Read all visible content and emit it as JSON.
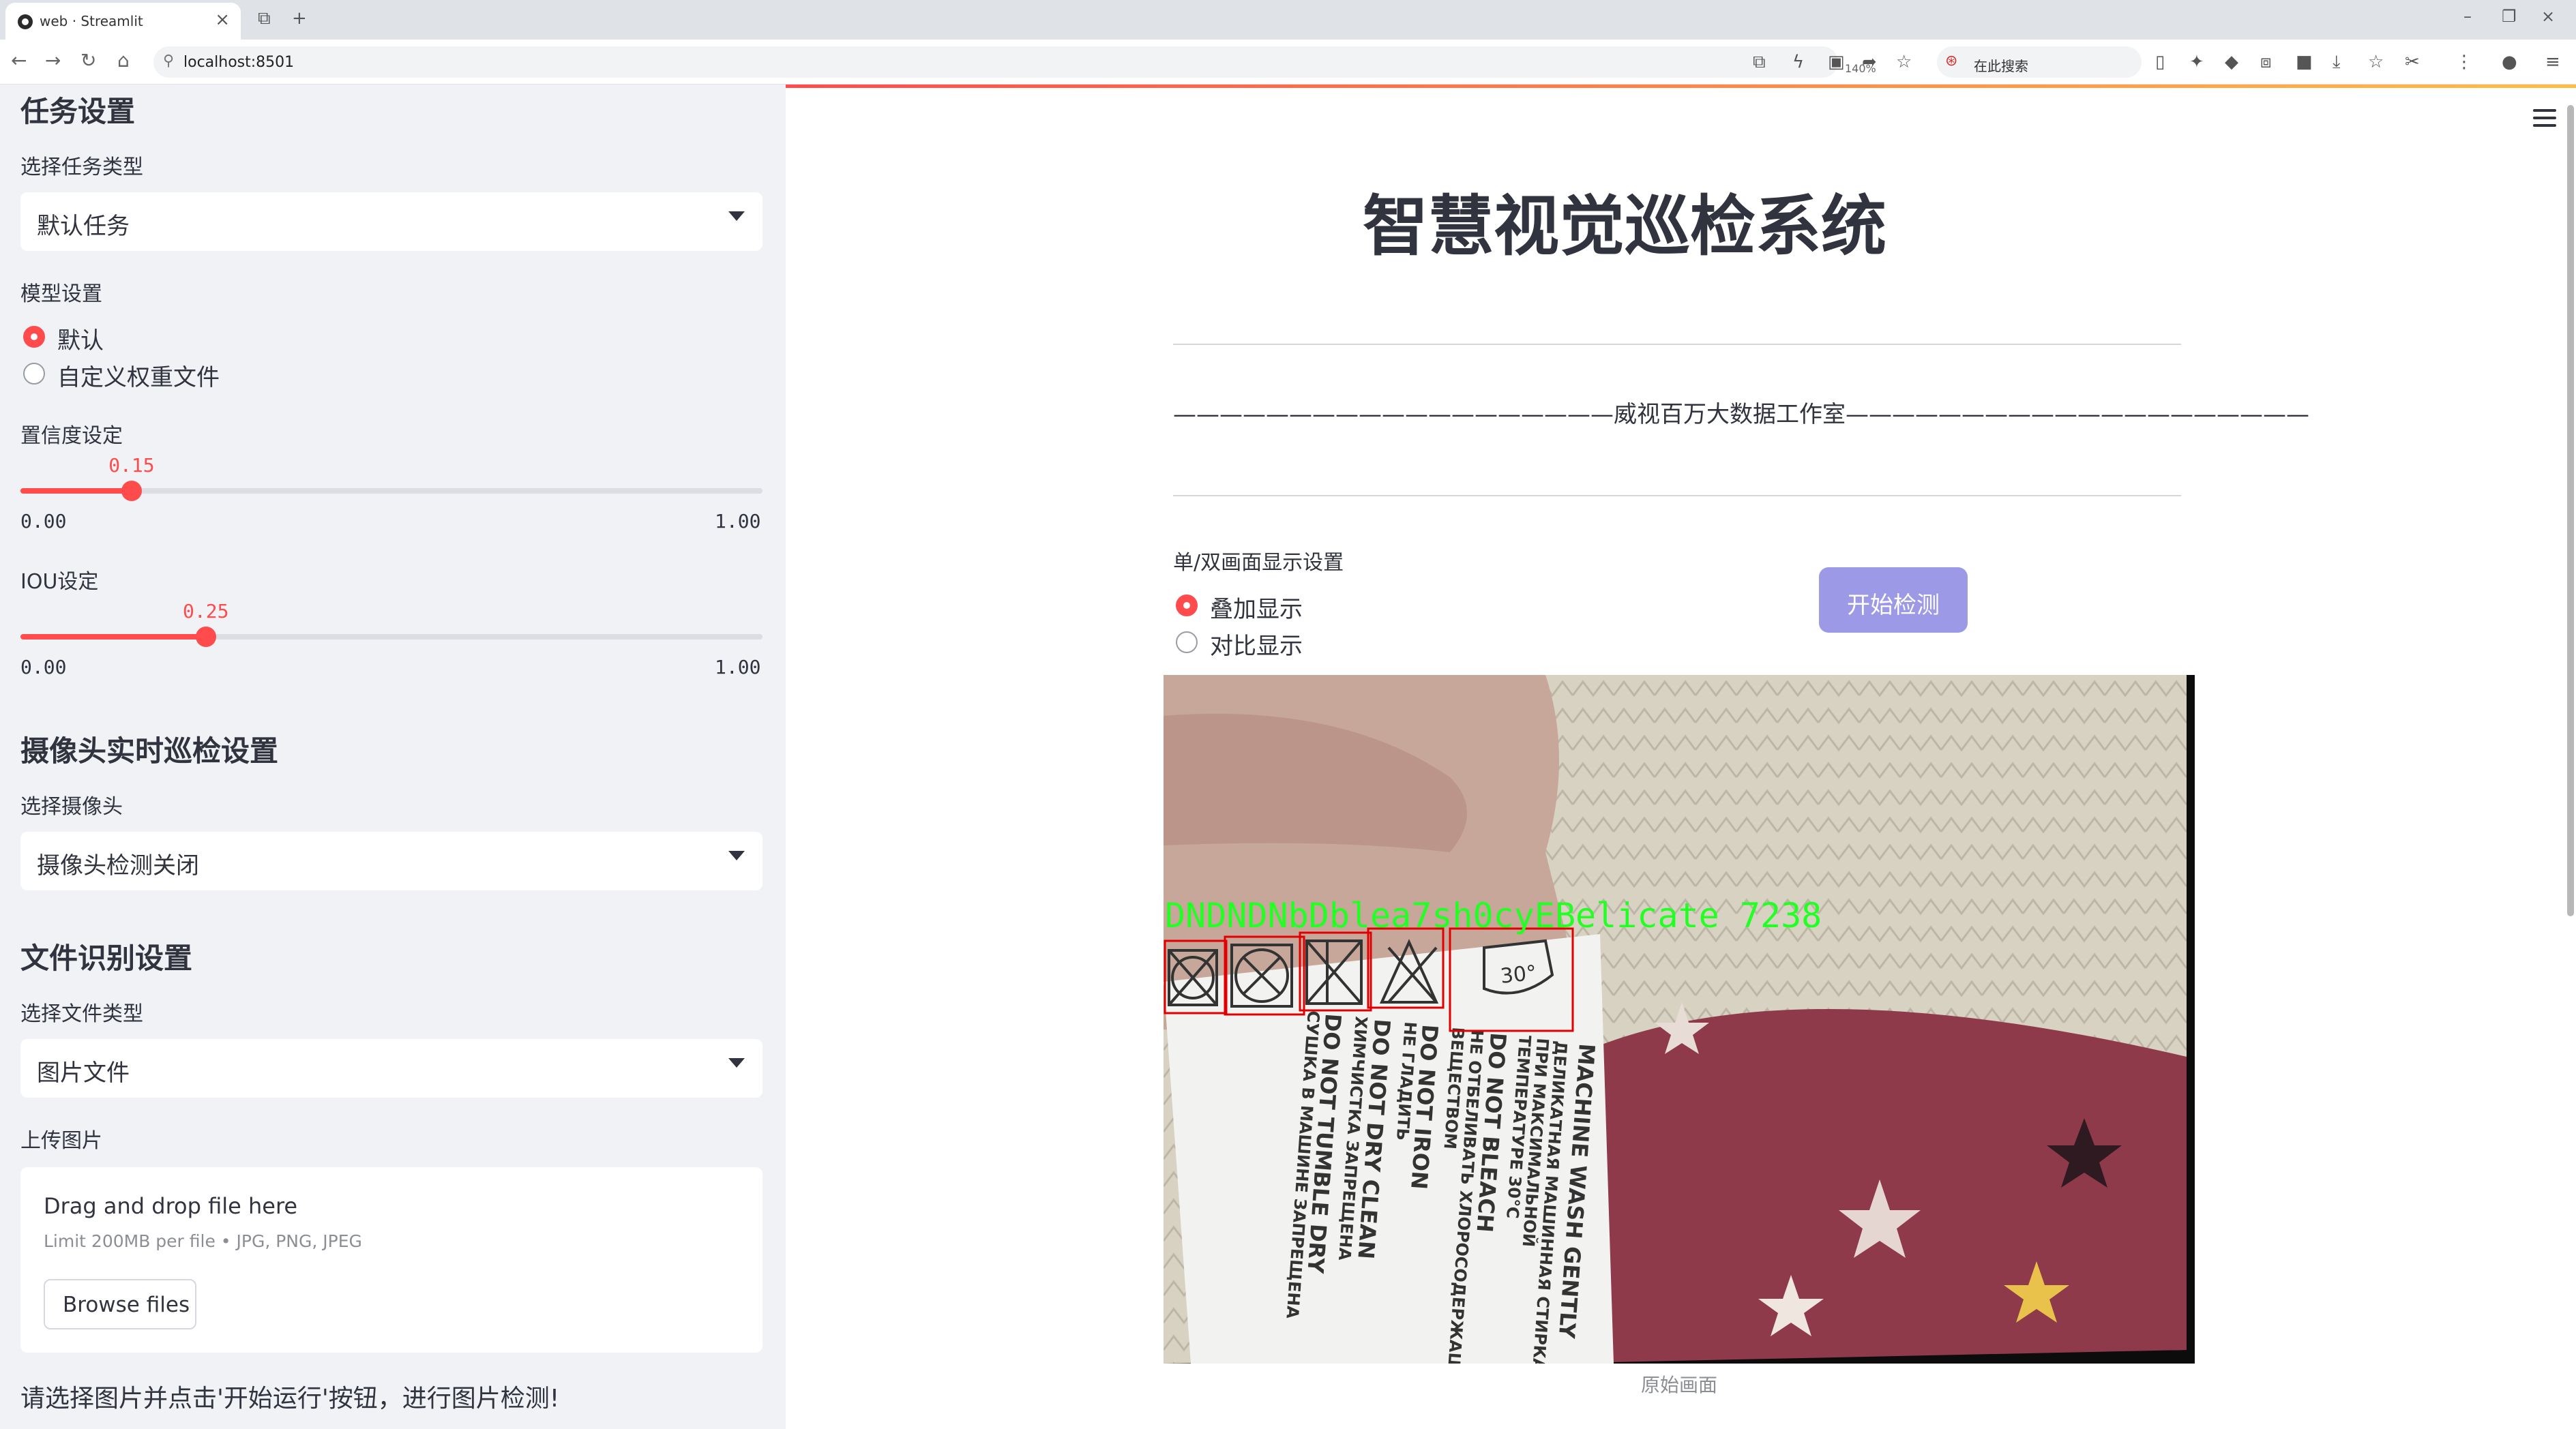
{
  "browser": {
    "tab_title": "web · Streamlit",
    "url": "localhost:8501",
    "zoom": "140%",
    "search_placeholder": "在此搜索"
  },
  "sidebar": {
    "task_section_title": "任务设置",
    "task_type_label": "选择任务类型",
    "task_type_value": "默认任务",
    "model_label": "模型设置",
    "model_options": [
      "默认",
      "自定义权重文件"
    ],
    "model_selected": "默认",
    "conf_label": "置信度设定",
    "conf_value": "0.15",
    "conf_min": "0.00",
    "conf_max": "1.00",
    "conf_fraction": 0.15,
    "iou_label": "IOU设定",
    "iou_value": "0.25",
    "iou_min": "0.00",
    "iou_max": "1.00",
    "iou_fraction": 0.25,
    "camera_section_title": "摄像头实时巡检设置",
    "camera_label": "选择摄像头",
    "camera_value": "摄像头检测关闭",
    "file_section_title": "文件识别设置",
    "file_type_label": "选择文件类型",
    "file_type_value": "图片文件",
    "upload_label": "上传图片",
    "upload_main": "Drag and drop file here",
    "upload_sub": "Limit 200MB per file • JPG, PNG, JPEG",
    "browse_label": "Browse files",
    "hint": "请选择图片并点击'开始运行'按钮，进行图片检测!"
  },
  "main": {
    "title": "智慧视觉巡检系统",
    "subtitle": "———————————————————威视百万大数据工作室————————————————————",
    "display_label": "单/双画面显示设置",
    "display_options": [
      "叠加显示",
      "对比显示"
    ],
    "display_selected": "叠加显示",
    "start_button": "开始检测",
    "caption": "原始画面",
    "detection_overlay_text": "DNDNDNbDblea7sh0cyEBelicate 7238",
    "label_lines": [
      "MACHINE WASH GENTLY",
      "ДЕЛИКАТНАЯ МАШИННАЯ СТИРКА",
      "ПРИ МАКСИМАЛЬНОЙ",
      "ТЕМПЕРАТУРЕ 30°C",
      "DO NOT BLEACH",
      "НЕ ОТБЕЛИВАТЬ ХЛОРОСОДЕРЖАЩИМ",
      "ВЕЩЕСТВОМ",
      "DO NOT IRON",
      "НЕ ГЛАДИТЬ",
      "DO NOT DRY CLEAN",
      "ХИМЧИСТКА ЗАПРЕЩЕНА",
      "DO NOT TUMBLE DRY",
      "СУШКА В МАШИНЕ ЗАПРЕЩЕНА"
    ],
    "wash_temp": "30°"
  },
  "colors": {
    "accent": "#ff4b4b",
    "sidebar_bg": "#f0f2f6",
    "button": "#9c99e6",
    "detection_green": "#22ff22",
    "bbox_red": "#e00000"
  }
}
